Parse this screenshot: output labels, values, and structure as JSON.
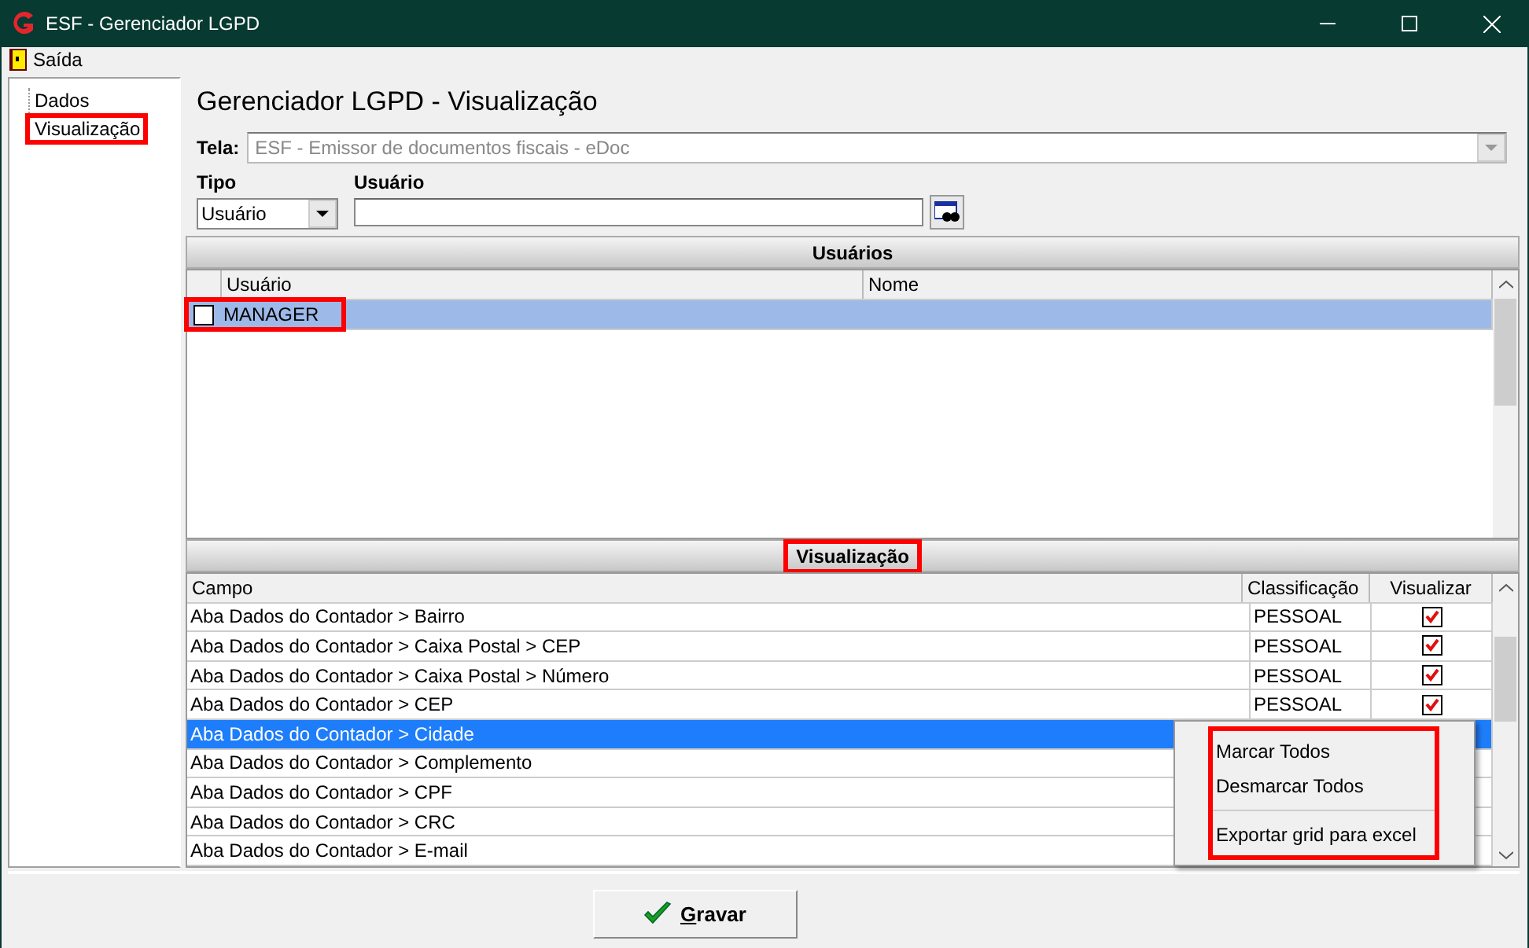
{
  "window": {
    "title": "ESF - Gerenciador LGPD"
  },
  "menu": [
    {
      "label": "Saída"
    }
  ],
  "tree": [
    {
      "label": "Dados",
      "highlighted": false
    },
    {
      "label": "Visualização",
      "highlighted": true
    }
  ],
  "heading": "Gerenciador LGPD - Visualização",
  "tela": {
    "label": "Tela:",
    "value": "ESF - Emissor de documentos fiscais - eDoc",
    "disabled": true
  },
  "filters": {
    "tipo": {
      "label": "Tipo",
      "value": "Usuário"
    },
    "usuario": {
      "label": "Usuário"
    }
  },
  "users": {
    "title": "Usuários",
    "columns": [
      "Usuário",
      "Nome"
    ],
    "rows": [
      {
        "usuario": "MANAGER",
        "checked": false,
        "selected": true,
        "highlighted": true
      }
    ]
  },
  "fields": {
    "title": "Visualização",
    "title_highlighted": true,
    "columns": [
      "Campo",
      "Classificação",
      "Visualizar"
    ],
    "rows": [
      {
        "campo": "Aba Dados do Contador > Bairro",
        "classificacao": "PESSOAL",
        "visualizar": true,
        "selected": false
      },
      {
        "campo": "Aba Dados do Contador > Caixa Postal > CEP",
        "classificacao": "PESSOAL",
        "visualizar": true,
        "selected": false
      },
      {
        "campo": "Aba Dados do Contador > Caixa Postal > Número",
        "classificacao": "PESSOAL",
        "visualizar": true,
        "selected": false
      },
      {
        "campo": "Aba Dados do Contador > CEP",
        "classificacao": "PESSOAL",
        "visualizar": true,
        "selected": false
      },
      {
        "campo": "Aba Dados do Contador > Cidade",
        "selected": true
      },
      {
        "campo": "Aba Dados do Contador > Complemento",
        "selected": false
      },
      {
        "campo": "Aba Dados do Contador > CPF",
        "selected": false
      },
      {
        "campo": "Aba Dados do Contador > CRC",
        "selected": false
      },
      {
        "campo": "Aba Dados do Contador > E-mail",
        "selected": false
      }
    ]
  },
  "context_menu": {
    "highlighted": true,
    "items": [
      {
        "kind": "item",
        "label": "Marcar Todos"
      },
      {
        "kind": "item",
        "label": "Desmarcar Todos"
      },
      {
        "kind": "separator"
      },
      {
        "kind": "item",
        "label": "Exportar grid para excel"
      }
    ]
  },
  "save_button": {
    "label": "Gravar"
  }
}
